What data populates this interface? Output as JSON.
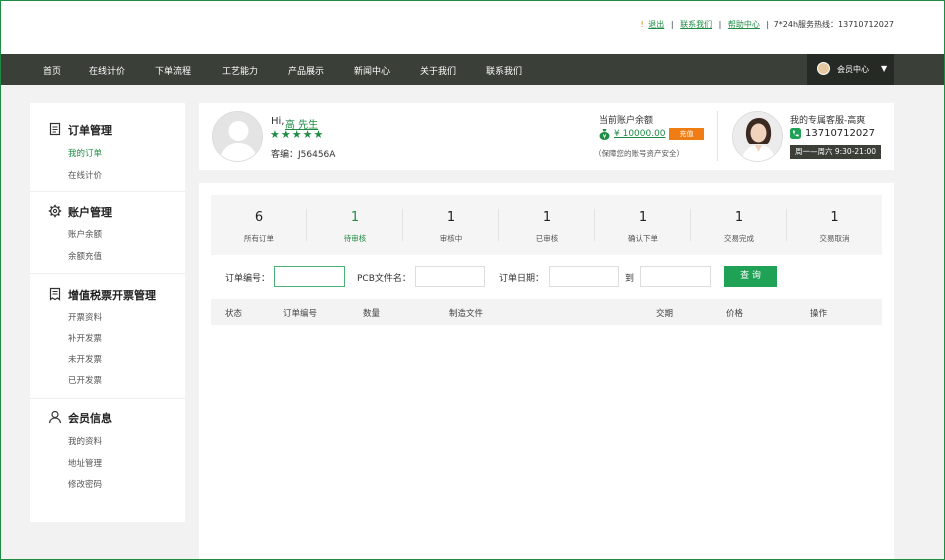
{
  "top_links": {
    "exclaim": "!",
    "logout": "退出",
    "contact": "联系我们",
    "help": "帮助中心",
    "hotline": "7*24h服务热线：13710712027"
  },
  "nav": {
    "items": [
      "首页",
      "在线计价",
      "下单流程",
      "工艺能力",
      "产品展示",
      "新闻中心",
      "关于我们",
      "联系我们"
    ],
    "member_center": "会员中心"
  },
  "sidebar": {
    "sections": [
      {
        "title": "订单管理",
        "icon": "document-icon",
        "items": [
          "我的订单",
          "在线计价"
        ]
      },
      {
        "title": "账户管理",
        "icon": "gear-icon",
        "items": [
          "账户余额",
          "余额充值"
        ]
      },
      {
        "title": "增值税票开票管理",
        "icon": "invoice-icon",
        "items": [
          "开票资料",
          "补开发票",
          "未开发票",
          "已开发票"
        ]
      },
      {
        "title": "会员信息",
        "icon": "user-icon",
        "items": [
          "我的资料",
          "地址管理",
          "修改密码"
        ]
      }
    ]
  },
  "profile": {
    "greeting": "Hi,",
    "name": "高 先生",
    "stars": "★★★★★",
    "customer_code": "客编：J56456A",
    "balance_label": "当前账户余额",
    "balance_value": "¥ 10000.00",
    "recharge": "充值",
    "security_note": "（保障您的账号资产安全）",
    "service_title": "我的专属客服-高爽",
    "service_phone": "13710712027",
    "service_hours": "周一—周六 9:30-21:00"
  },
  "stats": [
    {
      "count": "6",
      "label": "所有订单"
    },
    {
      "count": "1",
      "label": "待审核"
    },
    {
      "count": "1",
      "label": "审核中"
    },
    {
      "count": "1",
      "label": "已审核"
    },
    {
      "count": "1",
      "label": "确认下单"
    },
    {
      "count": "1",
      "label": "交易完成"
    },
    {
      "count": "1",
      "label": "交易取消"
    }
  ],
  "search": {
    "order_no_label": "订单编号：",
    "pcb_label": "PCB文件名：",
    "date_label": "订单日期：",
    "to_label": "到",
    "button": "查 询",
    "order_no_value": "",
    "pcb_value": "",
    "date_from": "",
    "date_to": ""
  },
  "table": {
    "headers": [
      "状态",
      "订单编号",
      "数量",
      "制造文件",
      "交期",
      "价格",
      "操作"
    ]
  },
  "colors": {
    "accent": "#1f8c44",
    "nav_bg": "#3a3f38",
    "button": "#1fa255",
    "recharge": "#f07c14"
  }
}
